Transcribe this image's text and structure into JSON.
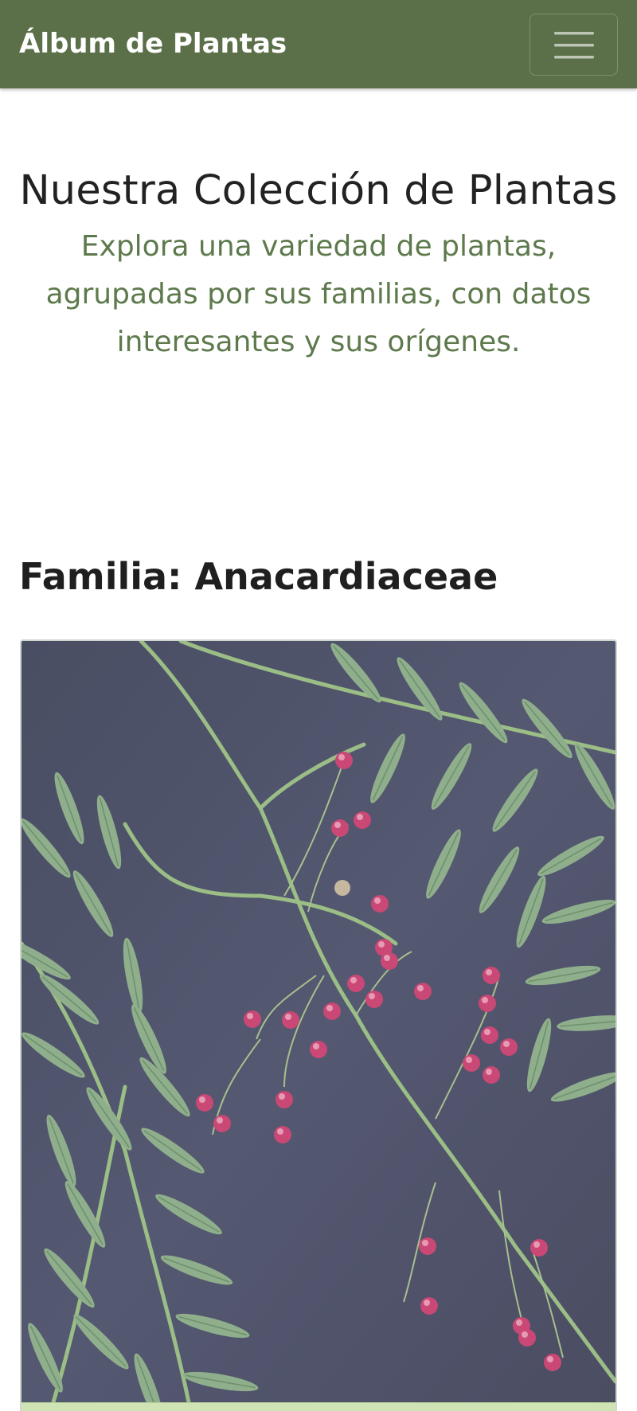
{
  "navbar": {
    "brand": "Álbum de Plantas",
    "toggler_icon": "hamburger-menu-icon",
    "background": "#5b7049"
  },
  "hero": {
    "title": "Nuestra Colección de Plantas",
    "subtitle": "Explora una variedad de plantas, agrupadas por sus familias, con datos interesantes y sus orígenes."
  },
  "family": {
    "heading": "Familia: Anacardiaceae"
  },
  "colors": {
    "accent_green": "#5e7a4d",
    "footer_green": "#cfe3b5"
  }
}
